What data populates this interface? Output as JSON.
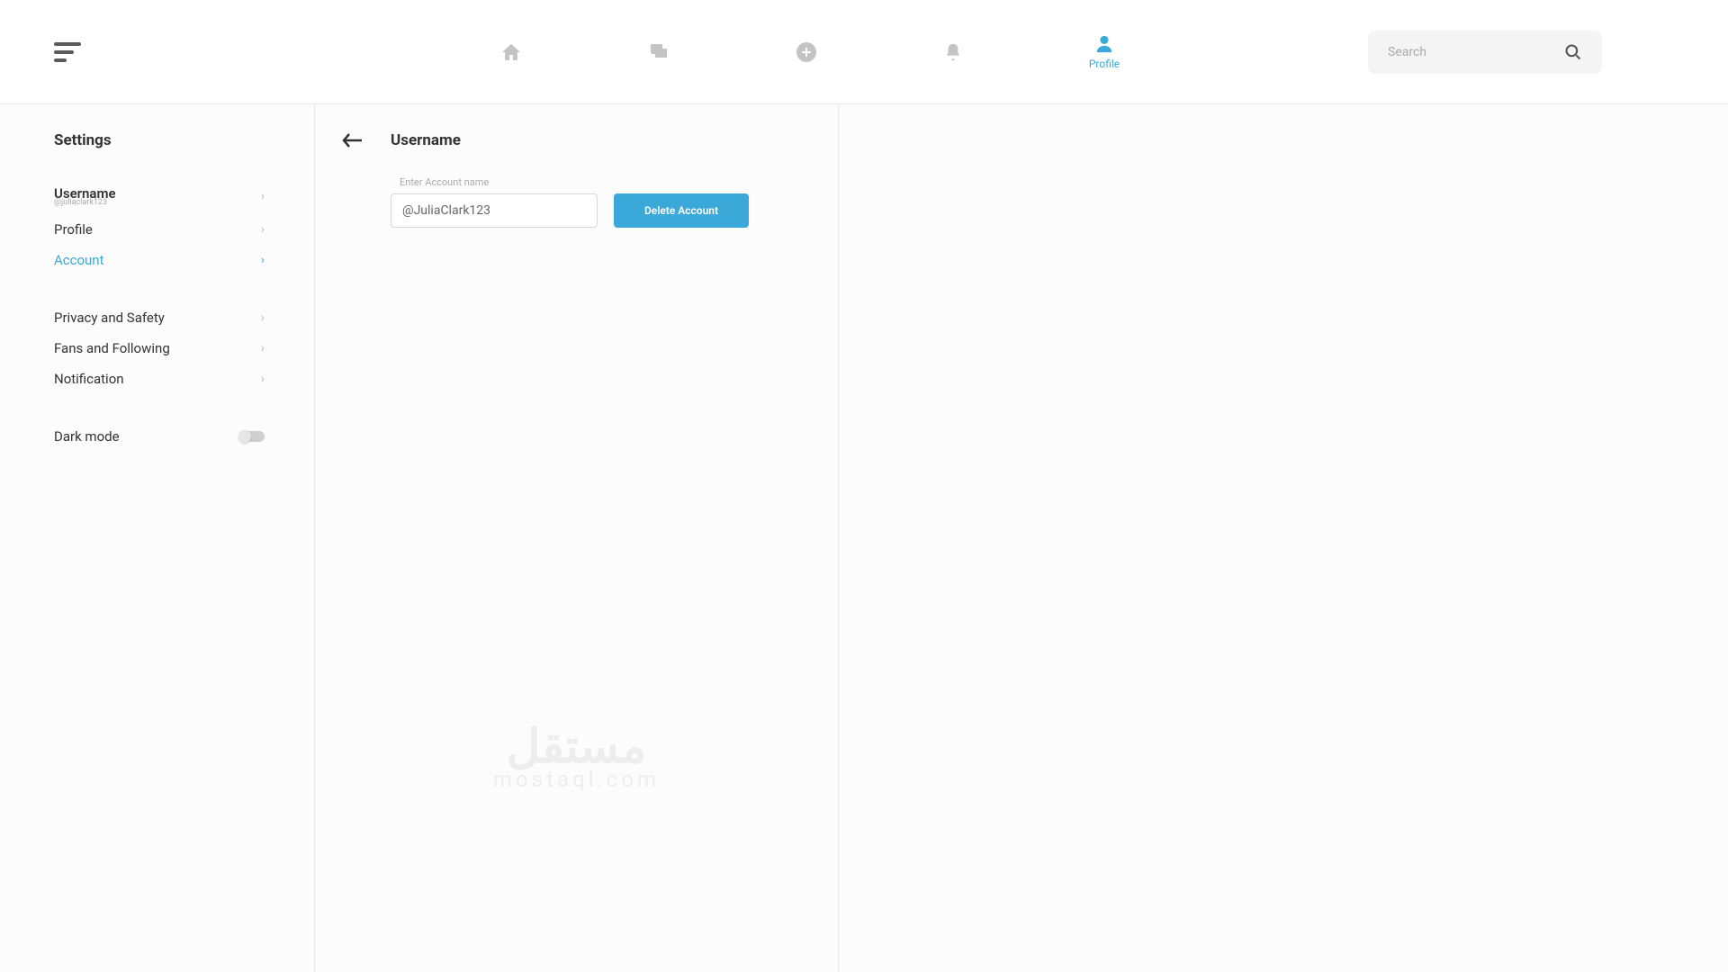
{
  "header": {
    "nav": {
      "profile_label": "Profile"
    },
    "search_placeholder": "Search"
  },
  "sidebar": {
    "title": "Settings",
    "items": [
      {
        "label": "Username",
        "sub": "@juliaclark123",
        "active": false
      },
      {
        "label": "Profile",
        "active": false
      },
      {
        "label": "Account",
        "active": true
      }
    ],
    "items2": [
      {
        "label": "Privacy and Safety"
      },
      {
        "label": "Fans and Following"
      },
      {
        "label": "Notification"
      }
    ],
    "dark_mode_label": "Dark mode"
  },
  "main": {
    "title": "Username",
    "field_label": "Enter Account name",
    "account_value": "@JuliaClark123",
    "delete_label": "Delete Account"
  },
  "watermark": {
    "top": "مستقل",
    "sub": "mostaql.com"
  },
  "colors": {
    "accent": "#3aa8d8",
    "icon_inactive": "#c4c4c4"
  }
}
